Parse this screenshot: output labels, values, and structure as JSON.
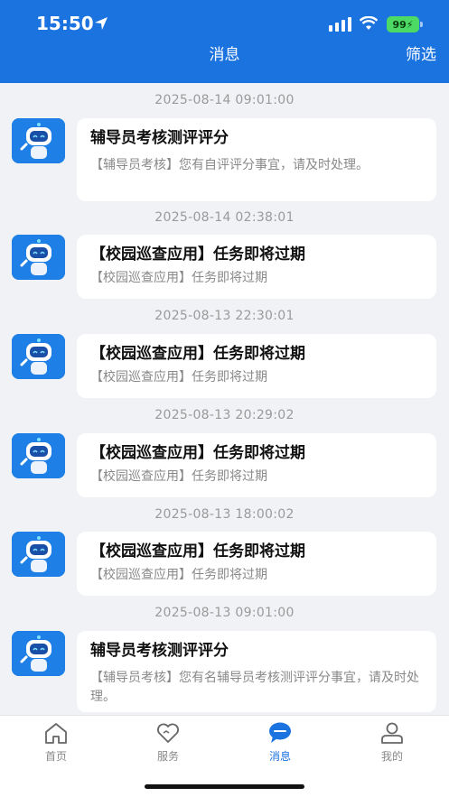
{
  "status_bar": {
    "time": "15:50",
    "battery": "99"
  },
  "nav": {
    "title": "消息",
    "filter_label": "筛选"
  },
  "messages": [
    {
      "time": "2025-08-14 09:01:00",
      "title": "辅导员考核测评评分",
      "body": "【辅导员考核】您有自评评分事宜，请及时处理。"
    },
    {
      "time": "2025-08-14 02:38:01",
      "title": "【校园巡查应用】任务即将过期",
      "body": "【校园巡查应用】任务即将过期"
    },
    {
      "time": "2025-08-13 22:30:01",
      "title": "【校园巡查应用】任务即将过期",
      "body": "【校园巡查应用】任务即将过期"
    },
    {
      "time": "2025-08-13 20:29:02",
      "title": "【校园巡查应用】任务即将过期",
      "body": "【校园巡查应用】任务即将过期"
    },
    {
      "time": "2025-08-13 18:00:02",
      "title": "【校园巡查应用】任务即将过期",
      "body": "【校园巡查应用】任务即将过期"
    },
    {
      "time": "2025-08-13 09:01:00",
      "title": "辅导员考核测评评分",
      "body": "【辅导员考核】您有名辅导员考核测评评分事宜，请及时处理。"
    }
  ],
  "tabs": [
    {
      "label": "首页",
      "icon": "home-icon"
    },
    {
      "label": "服务",
      "icon": "heart-icon"
    },
    {
      "label": "消息",
      "icon": "chat-icon",
      "active": true
    },
    {
      "label": "我的",
      "icon": "user-icon"
    }
  ],
  "colors": {
    "brand": "#1b73e0",
    "background": "#f0f2f5",
    "battery": "#4cd964"
  }
}
